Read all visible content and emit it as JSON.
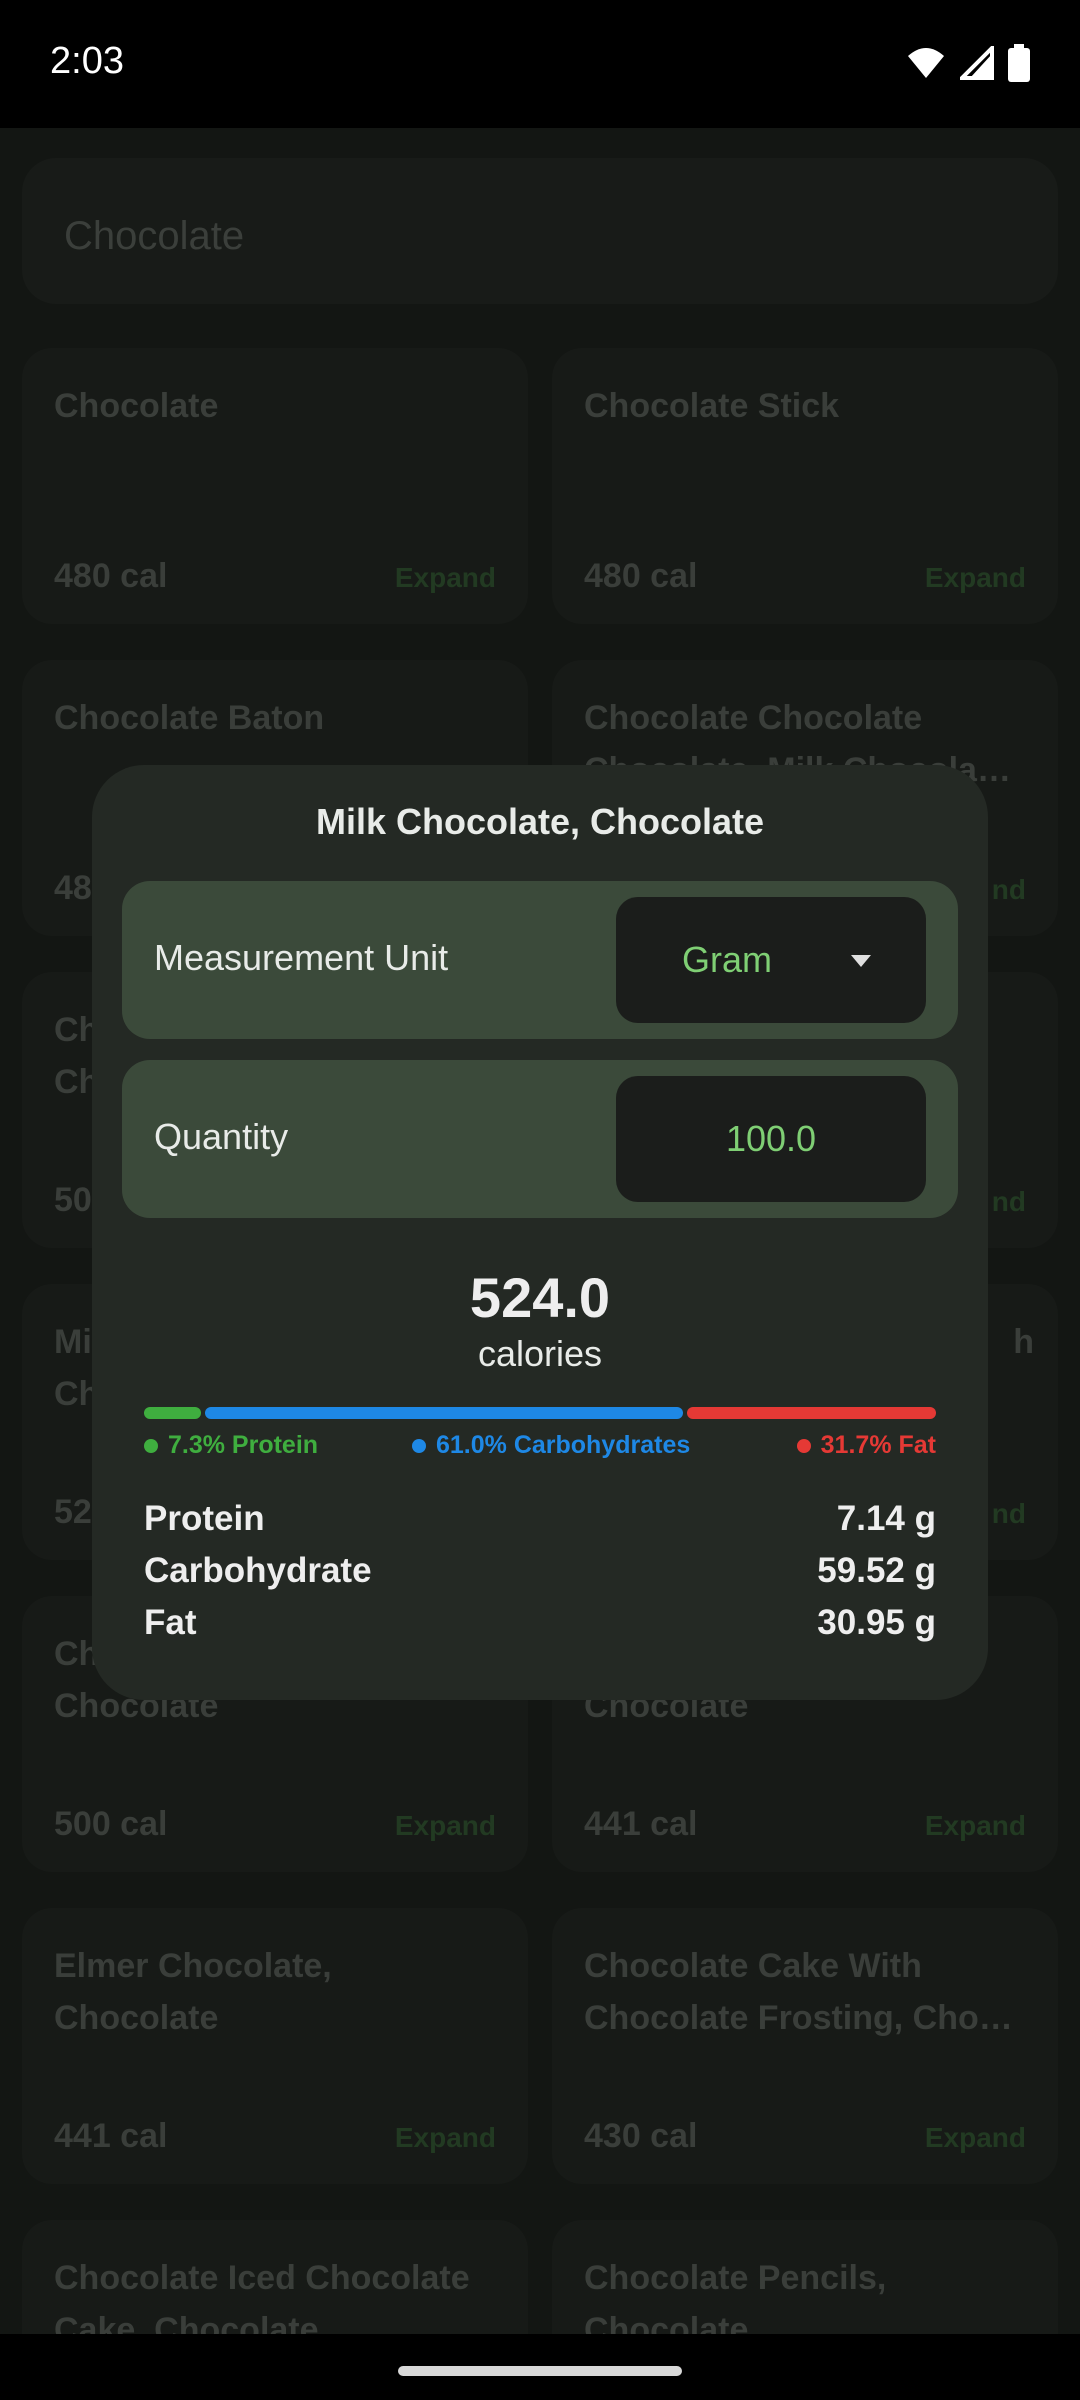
{
  "status_bar": {
    "time": "2:03",
    "icons": [
      "wifi-icon",
      "cell-signal-icon",
      "battery-icon"
    ]
  },
  "search": {
    "query": "Chocolate"
  },
  "cards": [
    {
      "name": "Chocolate",
      "calories": "480 cal",
      "action": "Expand"
    },
    {
      "name": "Chocolate Stick",
      "calories": "480 cal",
      "action": "Expand"
    },
    {
      "name": "Chocolate Baton",
      "calories": "48",
      "action": ""
    },
    {
      "name": "Chocolate Chocolate Chocolate, Milk Chocola…",
      "calories": "",
      "action": "nd"
    },
    {
      "name": "Ch\nCh",
      "calories": "50",
      "action": ""
    },
    {
      "name": "",
      "calories": "",
      "action": "nd"
    },
    {
      "name": "Mi\nCh",
      "calories": "52",
      "action": ""
    },
    {
      "name": "h",
      "calories": "",
      "action": "nd"
    },
    {
      "name": "Ch\nChocolate",
      "calories": "500 cal",
      "action": "Expand"
    },
    {
      "name": "\nChocolate",
      "calories": "441 cal",
      "action": "Expand"
    },
    {
      "name": "Elmer Chocolate, Chocolate",
      "calories": "441 cal",
      "action": "Expand"
    },
    {
      "name": "Chocolate Cake With Chocolate Frosting, Cho…",
      "calories": "430 cal",
      "action": "Expand"
    },
    {
      "name": "Chocolate Iced Chocolate Cake, Chocolate",
      "calories": "",
      "action": ""
    },
    {
      "name": "Chocolate Pencils, Chocolate",
      "calories": "",
      "action": ""
    }
  ],
  "dialog": {
    "title": "Milk Chocolate, Chocolate",
    "unit_label": "Measurement Unit",
    "unit_value": "Gram",
    "quantity_label": "Quantity",
    "quantity_value": "100.0",
    "calories_value": "524.0",
    "calories_label": "calories",
    "macros": [
      {
        "label": "7.3% Protein",
        "percent": 7.3,
        "color": "#3fae3f"
      },
      {
        "label": "61.0% Carbohydrates",
        "percent": 61.0,
        "color": "#1e88e5"
      },
      {
        "label": "31.7% Fat",
        "percent": 31.7,
        "color": "#e53935"
      }
    ],
    "nutrients": [
      {
        "name": "Protein",
        "value": "7.14 g"
      },
      {
        "name": "Carbohydrate",
        "value": "59.52 g"
      },
      {
        "name": "Fat",
        "value": "30.95 g"
      }
    ]
  }
}
